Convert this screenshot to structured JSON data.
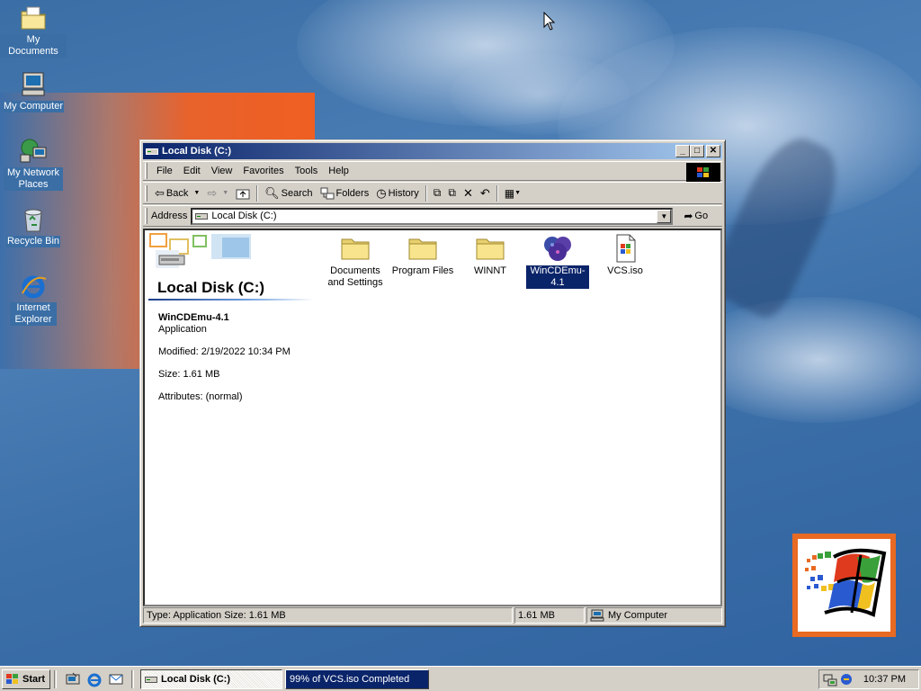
{
  "desktop": {
    "icons": [
      {
        "label": "My Documents",
        "icon": "folder-documents-icon"
      },
      {
        "label": "My Computer",
        "icon": "computer-icon"
      },
      {
        "label": "My Network Places",
        "icon": "network-icon"
      },
      {
        "label": "Recycle Bin",
        "icon": "recycle-bin-icon"
      },
      {
        "label": "Internet Explorer",
        "icon": "internet-explorer-icon"
      }
    ]
  },
  "window": {
    "title": "Local Disk (C:)",
    "menu": [
      "File",
      "Edit",
      "View",
      "Favorites",
      "Tools",
      "Help"
    ],
    "toolbar": {
      "back": "Back",
      "search": "Search",
      "folders": "Folders",
      "history": "History"
    },
    "address": {
      "label": "Address",
      "value": "Local Disk (C:)",
      "go": "Go"
    },
    "webview": {
      "folder_title": "Local Disk (C:)",
      "selected_name": "WinCDEmu-4.1",
      "selected_type": "Application",
      "modified": "Modified: 2/19/2022 10:34 PM",
      "size": "Size: 1.61 MB",
      "attributes": "Attributes: (normal)"
    },
    "files": [
      {
        "name": "Documents and Settings",
        "icon": "folder-icon",
        "selected": false
      },
      {
        "name": "Program Files",
        "icon": "folder-icon",
        "selected": false
      },
      {
        "name": "WINNT",
        "icon": "folder-icon",
        "selected": false
      },
      {
        "name": "WinCDEmu-4.1",
        "icon": "wincdemu-icon",
        "selected": true
      },
      {
        "name": "VCS.iso",
        "icon": "iso-file-icon",
        "selected": false
      }
    ],
    "status": {
      "left": "Type: Application Size: 1.61 MB",
      "size": "1.61 MB",
      "zone": "My Computer"
    }
  },
  "taskbar": {
    "start": "Start",
    "tasks": [
      "Local Disk (C:)",
      "99% of VCS.iso Completed"
    ],
    "clock": "10:37 PM"
  },
  "colors": {
    "desktop": "#3a6ea5",
    "title_active": "#0a246a",
    "selection": "#0a246a",
    "chrome": "#d4d0c8",
    "accent_orange": "#ef5f22"
  }
}
